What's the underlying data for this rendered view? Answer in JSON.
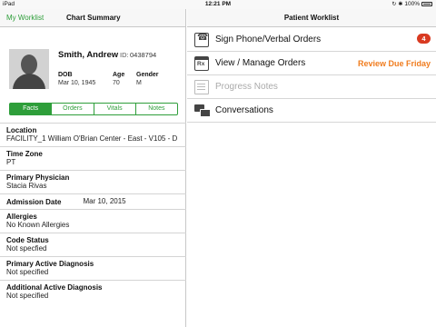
{
  "status_bar": {
    "carrier": "iPad",
    "time": "12:21 PM",
    "battery_text": "100%"
  },
  "left_panel": {
    "back_label": "My Worklist",
    "title": "Chart Summary",
    "patient": {
      "name": "Smith, Andrew",
      "id_label": "ID:",
      "id": "0438794",
      "dob_label": "DOB",
      "dob": "Mar 10, 1945",
      "age_label": "Age",
      "age": "70",
      "gender_label": "Gender",
      "gender": "M"
    },
    "tabs": [
      {
        "label": "Facts",
        "active": true
      },
      {
        "label": "Orders",
        "active": false
      },
      {
        "label": "Vitals",
        "active": false
      },
      {
        "label": "Notes",
        "active": false
      }
    ],
    "facts": [
      {
        "label": "Location",
        "value": "FACILITY_1 William O'Brian Center - East - V105 - D"
      },
      {
        "label": "Time Zone",
        "value": "PT"
      },
      {
        "label": "Primary Physician",
        "value": "Stacia Rivas"
      },
      {
        "label": "Admission Date",
        "value": "Mar 10, 2015"
      },
      {
        "label": "Allergies",
        "value": "No Known Allergies"
      },
      {
        "label": "Code Status",
        "value": "Not specfied"
      },
      {
        "label": "Primary Active Diagnosis",
        "value": "Not specified"
      },
      {
        "label": "Additional Active Diagnosis",
        "value": "Not specified"
      }
    ]
  },
  "right_panel": {
    "title": "Patient Worklist",
    "items": [
      {
        "label": "Sign Phone/Verbal Orders",
        "icon": "phone-order-icon",
        "badge": "4"
      },
      {
        "label": "View / Manage Orders",
        "icon": "rx-calendar-icon",
        "status": "Review Due Friday"
      },
      {
        "label": "Progress Notes",
        "icon": "notes-icon",
        "disabled": true
      },
      {
        "label": "Conversations",
        "icon": "conversation-icon"
      }
    ]
  },
  "colors": {
    "accent_green": "#2e9e3a",
    "badge_red": "#d93a21",
    "due_orange": "#f07c1e"
  }
}
